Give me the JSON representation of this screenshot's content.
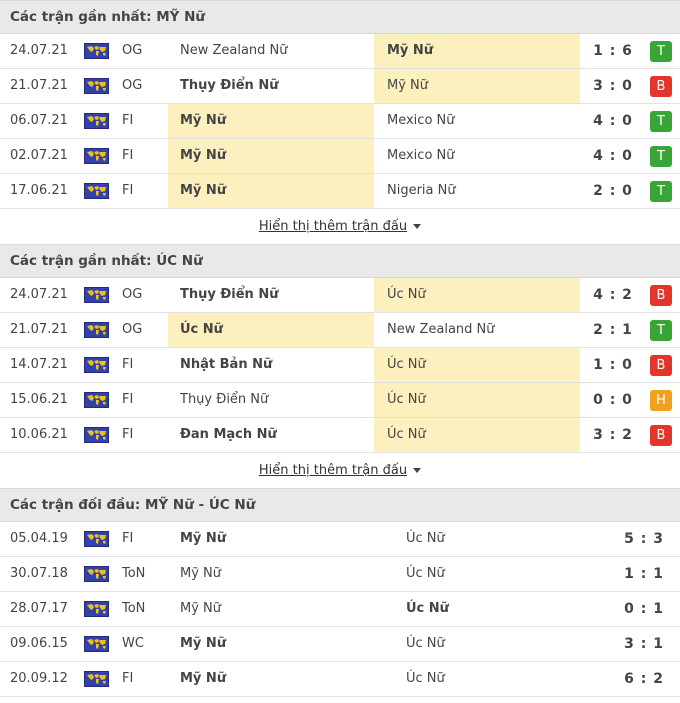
{
  "colors": {
    "win": "#3aa537",
    "loss": "#e5352b",
    "draw": "#f0a21c",
    "highlight": "#fcf0bf",
    "header_bg": "#e9e9e9",
    "flag": "#3341a8"
  },
  "sections": [
    {
      "title": "Các trận gần nhất: MỸ Nữ",
      "show_more": "Hiển thị thêm trận đấu",
      "type": "recent",
      "rows": [
        {
          "date": "24.07.21",
          "comp": "OG",
          "home": "New Zealand Nữ",
          "away": "Mỹ Nữ",
          "score": "1 : 6",
          "result": "T",
          "hl": "away",
          "bold": "away"
        },
        {
          "date": "21.07.21",
          "comp": "OG",
          "home": "Thụy Điển Nữ",
          "away": "Mỹ Nữ",
          "score": "3 : 0",
          "result": "B",
          "hl": "away",
          "bold": "home"
        },
        {
          "date": "06.07.21",
          "comp": "FI",
          "home": "Mỹ Nữ",
          "away": "Mexico Nữ",
          "score": "4 : 0",
          "result": "T",
          "hl": "home",
          "bold": "home"
        },
        {
          "date": "02.07.21",
          "comp": "FI",
          "home": "Mỹ Nữ",
          "away": "Mexico Nữ",
          "score": "4 : 0",
          "result": "T",
          "hl": "home",
          "bold": "home"
        },
        {
          "date": "17.06.21",
          "comp": "FI",
          "home": "Mỹ Nữ",
          "away": "Nigeria Nữ",
          "score": "2 : 0",
          "result": "T",
          "hl": "home",
          "bold": "home"
        }
      ]
    },
    {
      "title": "Các trận gần nhất: ÚC Nữ",
      "show_more": "Hiển thị thêm trận đấu",
      "type": "recent",
      "rows": [
        {
          "date": "24.07.21",
          "comp": "OG",
          "home": "Thụy Điển Nữ",
          "away": "Úc Nữ",
          "score": "4 : 2",
          "result": "B",
          "hl": "away",
          "bold": "home"
        },
        {
          "date": "21.07.21",
          "comp": "OG",
          "home": "Úc Nữ",
          "away": "New Zealand Nữ",
          "score": "2 : 1",
          "result": "T",
          "hl": "home",
          "bold": "home"
        },
        {
          "date": "14.07.21",
          "comp": "FI",
          "home": "Nhật Bản Nữ",
          "away": "Úc Nữ",
          "score": "1 : 0",
          "result": "B",
          "hl": "away",
          "bold": "home"
        },
        {
          "date": "15.06.21",
          "comp": "FI",
          "home": "Thụy Điển Nữ",
          "away": "Úc Nữ",
          "score": "0 : 0",
          "result": "H",
          "hl": "away",
          "bold": ""
        },
        {
          "date": "10.06.21",
          "comp": "FI",
          "home": "Đan Mạch Nữ",
          "away": "Úc Nữ",
          "score": "3 : 2",
          "result": "B",
          "hl": "away",
          "bold": "home"
        }
      ]
    },
    {
      "title": "Các trận đối đầu: MỸ Nữ - ÚC Nữ",
      "type": "h2h",
      "rows": [
        {
          "date": "05.04.19",
          "comp": "FI",
          "home": "Mỹ Nữ",
          "away": "Úc Nữ",
          "score": "5 : 3",
          "bold": "home"
        },
        {
          "date": "30.07.18",
          "comp": "ToN",
          "home": "Mỹ Nữ",
          "away": "Úc Nữ",
          "score": "1 : 1",
          "bold": ""
        },
        {
          "date": "28.07.17",
          "comp": "ToN",
          "home": "Mỹ Nữ",
          "away": "Úc Nữ",
          "score": "0 : 1",
          "bold": "away"
        },
        {
          "date": "09.06.15",
          "comp": "WC",
          "home": "Mỹ Nữ",
          "away": "Úc Nữ",
          "score": "3 : 1",
          "bold": "home"
        },
        {
          "date": "20.09.12",
          "comp": "FI",
          "home": "Mỹ Nữ",
          "away": "Úc Nữ",
          "score": "6 : 2",
          "bold": "home"
        }
      ]
    }
  ]
}
